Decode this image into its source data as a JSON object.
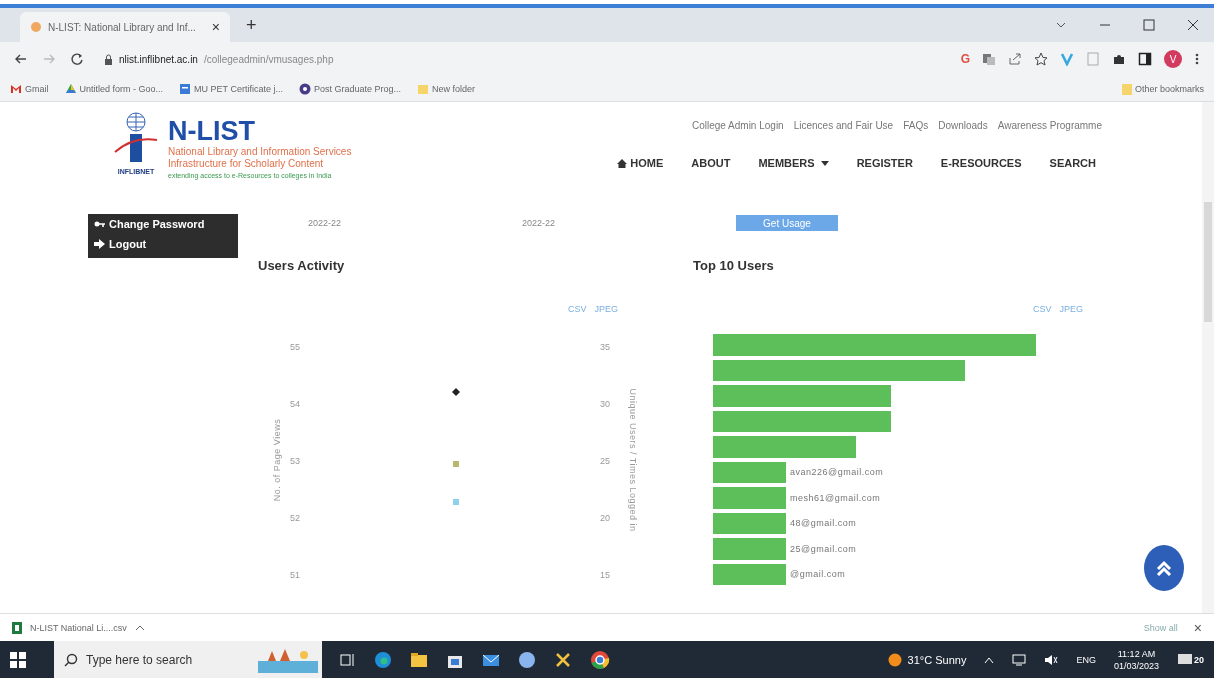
{
  "browser": {
    "tab_title": "N-LIST: National Library and Inf...",
    "tab_close": "×",
    "new_tab": "+",
    "extension_letter": "G",
    "url_host": "nlist.inflibnet.ac.in",
    "url_path": "/collegeadmin/vmusages.php",
    "bookmarks": [
      {
        "label": "Gmail",
        "kind": "gmail"
      },
      {
        "label": "Untitled form - Goo...",
        "kind": "drive"
      },
      {
        "label": "MU PET Certificate j...",
        "kind": "doc"
      },
      {
        "label": "Post Graduate Prog...",
        "kind": "globe"
      },
      {
        "label": "New folder",
        "kind": "folder"
      }
    ],
    "other_bookmarks": "Other bookmarks",
    "profile_initial": "V"
  },
  "header": {
    "logo_caption": "INFLIBNET",
    "site_name": "N-LIST",
    "tagline_1": "National Library and Information Services",
    "tagline_2": "Infrastructure for Scholarly Content",
    "tagline_3": "extending access to e-Resources to colleges in India",
    "top_links": [
      "College Admin Login",
      "Licences and Fair Use",
      "FAQs",
      "Downloads",
      "Awareness Programme"
    ],
    "nav": [
      {
        "label": "HOME",
        "kind": "home"
      },
      {
        "label": "ABOUT",
        "kind": "plain"
      },
      {
        "label": "MEMBERS",
        "kind": "dropdown"
      },
      {
        "label": "REGISTER",
        "kind": "plain"
      },
      {
        "label": "E-RESOURCES",
        "kind": "plain"
      },
      {
        "label": "SEARCH",
        "kind": "plain"
      }
    ]
  },
  "sidebar": {
    "items": [
      {
        "label": "Change Password",
        "kind": "key"
      },
      {
        "label": "Logout",
        "kind": "logout"
      }
    ]
  },
  "filter": {
    "from": "2022-22",
    "to": "2022-22",
    "button": "Get Usage"
  },
  "users_activity": {
    "title": "Users Activity",
    "exports": [
      "CSV",
      "JPEG"
    ],
    "left_axis": {
      "label": "No. of Page Views",
      "ticks": [
        "55",
        "54",
        "53",
        "52",
        "51"
      ]
    },
    "points": [
      {
        "color": "#222222",
        "kind": "diamond"
      },
      {
        "color": "#b8bb6e",
        "kind": "square"
      },
      {
        "color": "#8fd0ee",
        "kind": "square"
      }
    ],
    "right_axis": {
      "label": "Unique Users / Times Logged in",
      "ticks": [
        "35",
        "30",
        "25",
        "20",
        "15"
      ]
    }
  },
  "top_users": {
    "title": "Top 10 Users",
    "exports": [
      "CSV",
      "JPEG"
    ],
    "bars": [
      {
        "kind": "plain"
      },
      {
        "kind": "plain"
      },
      {
        "kind": "plain"
      },
      {
        "kind": "plain"
      },
      {
        "kind": "plain"
      },
      {
        "kind": "labelled",
        "label": "avan226@gmail.com"
      },
      {
        "kind": "labelled",
        "label": "mesh61@gmail.com"
      },
      {
        "kind": "labelled",
        "label": "48@gmail.com"
      },
      {
        "kind": "labelled",
        "label": "25@gmail.com"
      },
      {
        "kind": "labelled",
        "label": "@gmail.com"
      }
    ]
  },
  "download_bar": {
    "file": "N-LIST National Li....csv",
    "show_all": "Show all",
    "close": "×"
  },
  "taskbar": {
    "search_placeholder": "Type here to search",
    "weather": "31°C  Sunny",
    "language": "ENG",
    "time": "11:12 AM",
    "date": "01/03/2023",
    "notifications": "20"
  }
}
